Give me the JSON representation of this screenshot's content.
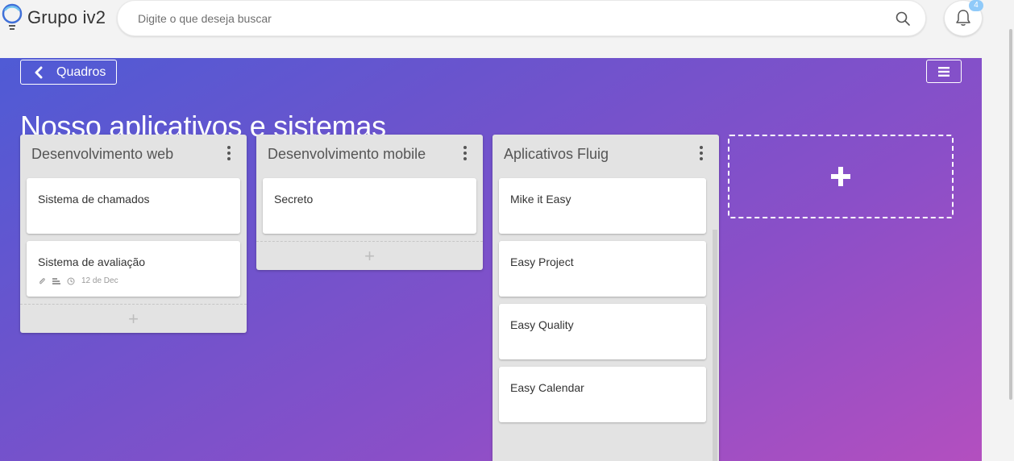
{
  "app": {
    "name": "Grupo iv2"
  },
  "search": {
    "placeholder": "Digite o que deseja buscar"
  },
  "notifications": {
    "count": "4"
  },
  "board": {
    "back_label": "Quadros",
    "title": "Nosso aplicativos e sistemas",
    "lists": [
      {
        "title": "Desenvolvimento web",
        "cards": [
          {
            "title": "Sistema de chamados"
          },
          {
            "title": "Sistema de avaliação",
            "meta": {
              "date": "12 de Dec",
              "icons": [
                "paperclip-icon",
                "checklist-icon",
                "clock-icon"
              ]
            }
          }
        ]
      },
      {
        "title": "Desenvolvimento mobile",
        "cards": [
          {
            "title": "Secreto"
          }
        ]
      },
      {
        "title": "Aplicativos Fluig",
        "cards": [
          {
            "title": "Mike it Easy"
          },
          {
            "title": "Easy Project"
          },
          {
            "title": "Easy Quality"
          },
          {
            "title": "Easy Calendar"
          }
        ]
      }
    ]
  },
  "colors": {
    "gradient_start": "#4f5bd5",
    "gradient_end": "#b34fbf",
    "list_bg": "#e3e3e3"
  }
}
